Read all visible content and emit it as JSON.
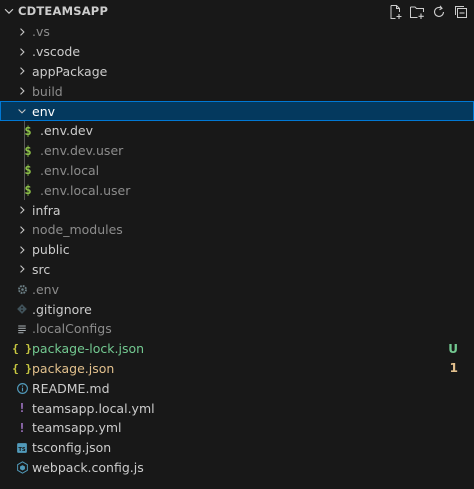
{
  "explorer": {
    "title": "CDTEAMSAPP",
    "actions": [
      {
        "name": "new-file-icon",
        "icon": "new-file"
      },
      {
        "name": "new-folder-icon",
        "icon": "new-folder"
      },
      {
        "name": "refresh-icon",
        "icon": "refresh"
      },
      {
        "name": "collapse-all-icon",
        "icon": "collapse-all"
      }
    ],
    "colors": {
      "background": "#181818",
      "selection": "#04395e",
      "selection_border": "#0078d4",
      "text": "#cccccc",
      "dimmed": "#8c8c8c",
      "untracked": "#73c991",
      "modified": "#e2c08d",
      "dollar_icon": "#8dc149"
    },
    "items": [
      {
        "label": ".vs",
        "type": "folder",
        "expanded": false,
        "depth": 0,
        "dim": true
      },
      {
        "label": ".vscode",
        "type": "folder",
        "expanded": false,
        "depth": 0
      },
      {
        "label": "appPackage",
        "type": "folder",
        "expanded": false,
        "depth": 0
      },
      {
        "label": "build",
        "type": "folder",
        "expanded": false,
        "depth": 0,
        "dim": true
      },
      {
        "label": "env",
        "type": "folder",
        "expanded": true,
        "depth": 0,
        "selected": true
      },
      {
        "label": ".env.dev",
        "type": "file",
        "icon": "dollar",
        "depth": 1
      },
      {
        "label": ".env.dev.user",
        "type": "file",
        "icon": "dollar",
        "depth": 1,
        "dim": true
      },
      {
        "label": ".env.local",
        "type": "file",
        "icon": "dollar",
        "depth": 1,
        "dim": true
      },
      {
        "label": ".env.local.user",
        "type": "file",
        "icon": "dollar",
        "depth": 1,
        "dim": true
      },
      {
        "label": "infra",
        "type": "folder",
        "expanded": false,
        "depth": 0
      },
      {
        "label": "node_modules",
        "type": "folder",
        "expanded": false,
        "depth": 0,
        "dim": true
      },
      {
        "label": "public",
        "type": "folder",
        "expanded": false,
        "depth": 0
      },
      {
        "label": "src",
        "type": "folder",
        "expanded": false,
        "depth": 0
      },
      {
        "label": ".env",
        "type": "file",
        "icon": "gear",
        "depth": 0,
        "dim": true
      },
      {
        "label": ".gitignore",
        "type": "file",
        "icon": "git",
        "depth": 0
      },
      {
        "label": ".localConfigs",
        "type": "file",
        "icon": "lines",
        "depth": 0,
        "dim": true
      },
      {
        "label": "package-lock.json",
        "type": "file",
        "icon": "braces",
        "depth": 0,
        "status": "untracked",
        "badge": "U"
      },
      {
        "label": "package.json",
        "type": "file",
        "icon": "braces",
        "depth": 0,
        "status": "modified",
        "badge": "1"
      },
      {
        "label": "README.md",
        "type": "file",
        "icon": "info",
        "depth": 0
      },
      {
        "label": "teamsapp.local.yml",
        "type": "file",
        "icon": "exclaim",
        "depth": 0
      },
      {
        "label": "teamsapp.yml",
        "type": "file",
        "icon": "exclaim",
        "depth": 0
      },
      {
        "label": "tsconfig.json",
        "type": "file",
        "icon": "ts",
        "depth": 0
      },
      {
        "label": "webpack.config.js",
        "type": "file",
        "icon": "webpack",
        "depth": 0
      }
    ]
  }
}
